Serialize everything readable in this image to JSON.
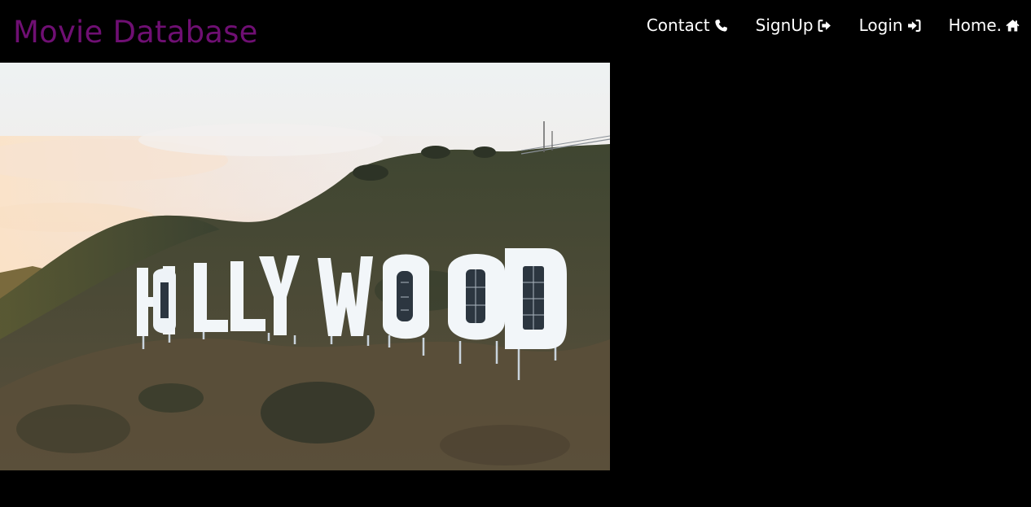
{
  "navbar": {
    "brand": "Movie Database",
    "brand_color": "#6f0f73",
    "links": [
      {
        "label": "Contact",
        "icon": "phone-icon"
      },
      {
        "label": "SignUp",
        "icon": "sign-out-icon"
      },
      {
        "label": "Login",
        "icon": "sign-in-icon"
      },
      {
        "label": "Home.",
        "icon": "home-icon"
      }
    ]
  },
  "hero": {
    "image": "hollywood-sign-photo",
    "sign_text": "HOLLYWOOD"
  }
}
